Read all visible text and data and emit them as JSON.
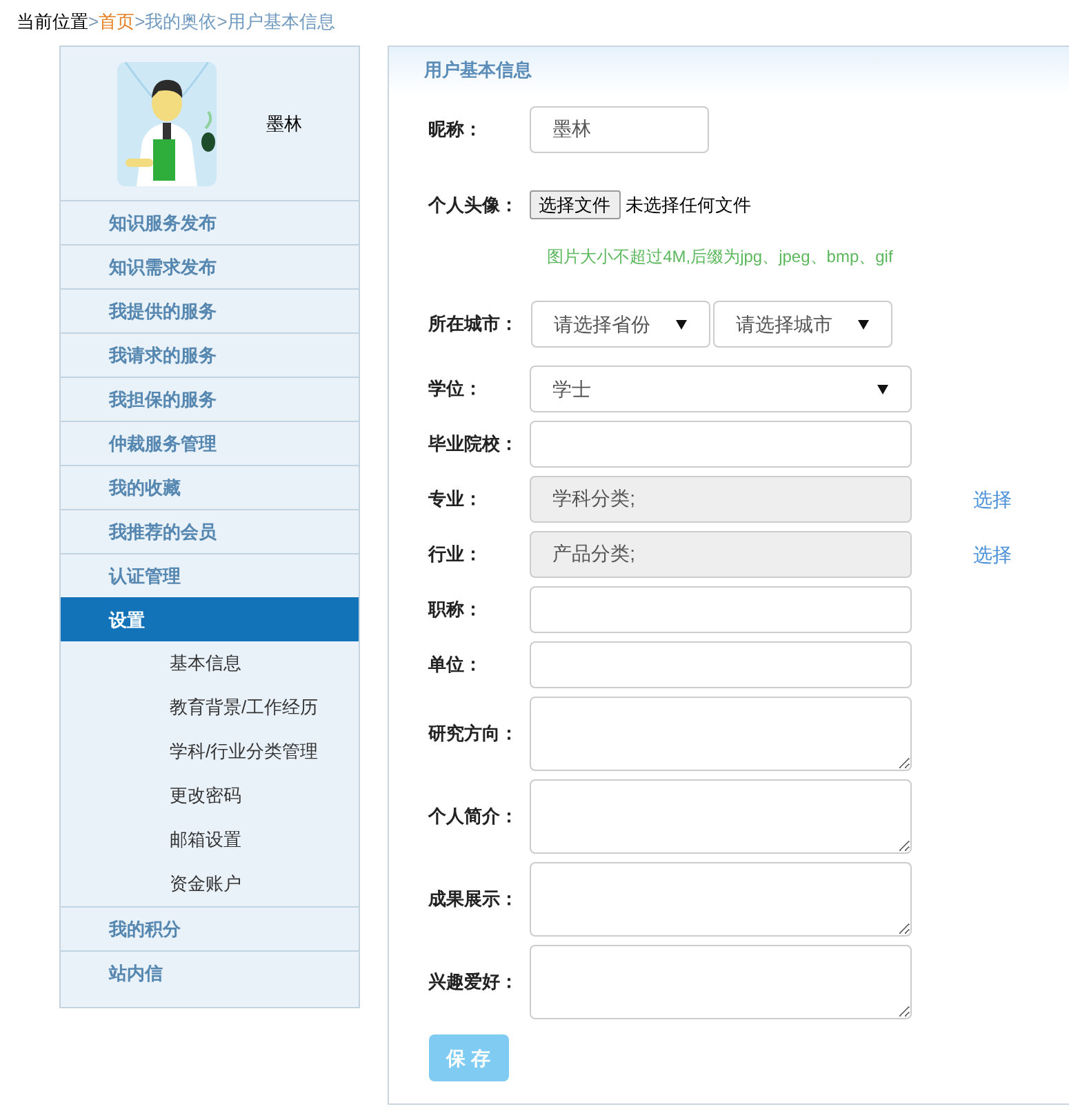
{
  "breadcrumb": [
    {
      "text": "当前位置",
      "kind": "label"
    },
    {
      "text": ">",
      "kind": "sep"
    },
    {
      "text": "首页",
      "kind": "home"
    },
    {
      "text": ">",
      "kind": "sep"
    },
    {
      "text": "我的奥依",
      "kind": "link"
    },
    {
      "text": ">",
      "kind": "sep"
    },
    {
      "text": "用户基本信息",
      "kind": "link"
    }
  ],
  "profile": {
    "name": "墨林"
  },
  "sidebar": {
    "items": [
      {
        "label": "知识服务发布",
        "selected": false
      },
      {
        "label": "知识需求发布",
        "selected": false
      },
      {
        "label": "我提供的服务",
        "selected": false
      },
      {
        "label": "我请求的服务",
        "selected": false
      },
      {
        "label": "我担保的服务",
        "selected": false
      },
      {
        "label": "仲裁服务管理",
        "selected": false
      },
      {
        "label": "我的收藏",
        "selected": false
      },
      {
        "label": "我推荐的会员",
        "selected": false
      },
      {
        "label": "认证管理",
        "selected": false
      },
      {
        "label": "设置",
        "selected": true,
        "children": [
          {
            "label": "基本信息"
          },
          {
            "label": "教育背景/工作经历"
          },
          {
            "label": "学科/行业分类管理"
          },
          {
            "label": "更改密码"
          },
          {
            "label": "邮箱设置"
          },
          {
            "label": "资金账户"
          }
        ]
      },
      {
        "label": "我的积分",
        "selected": false
      },
      {
        "label": "站内信",
        "selected": false
      }
    ]
  },
  "panel": {
    "title": "用户基本信息",
    "rows": [
      {
        "kind": "short-input",
        "label": "昵称：",
        "value": "墨林"
      },
      {
        "kind": "file",
        "label": "个人头像：",
        "button": "选择文件",
        "status": "未选择任何文件",
        "hint": "图片大小不超过4M,后缀为jpg、jpeg、bmp、gif"
      },
      {
        "kind": "select-pair",
        "label": "所在城市：",
        "selects": [
          "请选择省份",
          "请选择城市"
        ]
      },
      {
        "kind": "select",
        "label": "学位：",
        "value": "学士"
      },
      {
        "kind": "input",
        "label": "毕业院校："
      },
      {
        "kind": "readonly",
        "label": "专业：",
        "value": "学科分类;",
        "link": "选择"
      },
      {
        "kind": "readonly",
        "label": "行业：",
        "value": "产品分类;",
        "link": "选择"
      },
      {
        "kind": "input",
        "label": "职称："
      },
      {
        "kind": "input",
        "label": "单位："
      },
      {
        "kind": "textarea",
        "label": "研究方向："
      },
      {
        "kind": "textarea",
        "label": "个人简介："
      },
      {
        "kind": "textarea",
        "label": "成果展示："
      },
      {
        "kind": "textarea",
        "label": "兴趣爱好："
      }
    ],
    "save_button": "保 存"
  }
}
